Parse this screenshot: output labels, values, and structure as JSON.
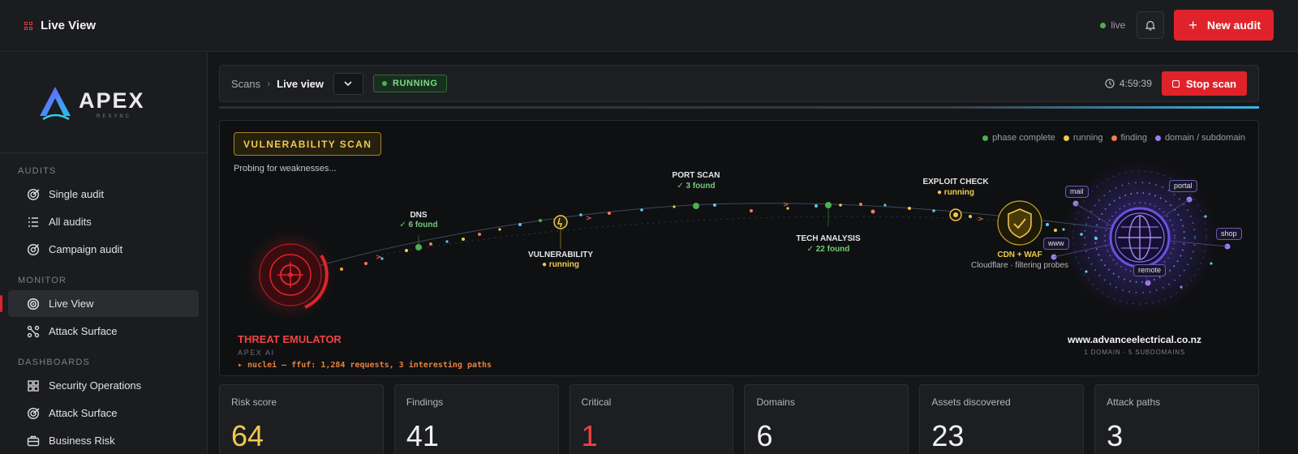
{
  "topbar": {
    "title": "Live View",
    "live_label": "live",
    "new_audit_label": "New audit",
    "bell_icon": "bell-icon"
  },
  "brand": {
    "name": "APEX",
    "sub": "RESYNC"
  },
  "sidebar": {
    "sections": [
      {
        "label": "AUDITS",
        "items": [
          {
            "label": "Single audit",
            "icon": "target-icon"
          },
          {
            "label": "All audits",
            "icon": "list-icon"
          },
          {
            "label": "Campaign audit",
            "icon": "campaign-icon"
          }
        ]
      },
      {
        "label": "MONITOR",
        "items": [
          {
            "label": "Live View",
            "icon": "radar-icon",
            "active": true
          },
          {
            "label": "Attack Surface",
            "icon": "network-icon"
          }
        ]
      },
      {
        "label": "DASHBOARDS",
        "items": [
          {
            "label": "Security Operations",
            "icon": "grid-icon"
          },
          {
            "label": "Attack Surface",
            "icon": "target-icon"
          },
          {
            "label": "Business Risk",
            "icon": "briefcase-icon"
          }
        ]
      }
    ]
  },
  "crumbs": {
    "root": "Scans",
    "sep": "›",
    "current": "Live view",
    "status": "RUNNING",
    "timer": "4:59:39",
    "stop_label": "Stop scan"
  },
  "viz": {
    "phase": "VULNERABILITY SCAN",
    "phase_sub": "Probing for weaknesses...",
    "legend": [
      {
        "label": "phase complete",
        "color": "#4caf50"
      },
      {
        "label": "running",
        "color": "#f2c94c"
      },
      {
        "label": "finding",
        "color": "#f07a5a"
      },
      {
        "label": "domain / subdomain",
        "color": "#9b7cf0"
      }
    ],
    "nodes": {
      "dns": {
        "label": "DNS",
        "sub": "✓ 6 found"
      },
      "vuln": {
        "label": "VULNERABILITY",
        "sub": "● running"
      },
      "port": {
        "label": "PORT SCAN",
        "sub": "✓ 3 found"
      },
      "tech": {
        "label": "TECH ANALYSIS",
        "sub": "✓ 22 found"
      },
      "exploit": {
        "label": "EXPLOIT CHECK",
        "sub": "● running"
      },
      "cdn": {
        "label": "CDN + WAF",
        "sub": "Cloudflare · filtering probes"
      }
    },
    "subdomains": {
      "mail": "mail",
      "portal": "portal",
      "www": "www",
      "shop": "shop",
      "remote": "remote"
    },
    "threat": {
      "title": "THREAT EMULATOR",
      "sub": "APEX AI",
      "log": "▸ nuclei — ffuf: 1,284 requests, 3 interesting paths"
    },
    "target": {
      "domain": "www.advanceelectrical.co.nz",
      "sub": "1 DOMAIN · 5 SUBDOMAINS"
    }
  },
  "stats": [
    {
      "label": "Risk score",
      "value": "64",
      "color": "#f2c94c"
    },
    {
      "label": "Findings",
      "value": "41",
      "color": "#f1f1f3"
    },
    {
      "label": "Critical",
      "value": "1",
      "color": "#ef4444"
    },
    {
      "label": "Domains",
      "value": "6",
      "color": "#f1f1f3"
    },
    {
      "label": "Assets discovered",
      "value": "23",
      "color": "#f1f1f3"
    },
    {
      "label": "Attack paths",
      "value": "3",
      "color": "#f1f1f3"
    }
  ]
}
